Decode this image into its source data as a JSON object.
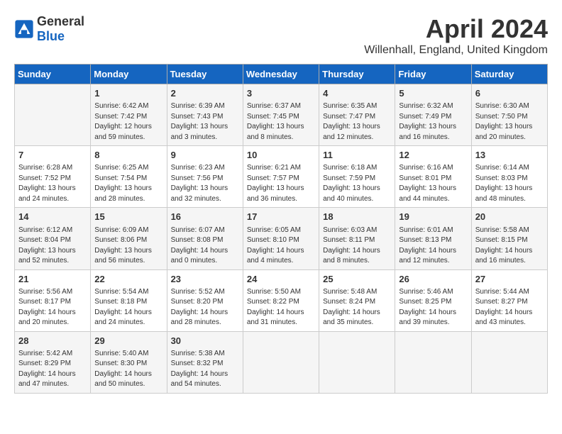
{
  "header": {
    "logo": {
      "general": "General",
      "blue": "Blue"
    },
    "title": "April 2024",
    "subtitle": "Willenhall, England, United Kingdom"
  },
  "columns": [
    "Sunday",
    "Monday",
    "Tuesday",
    "Wednesday",
    "Thursday",
    "Friday",
    "Saturday"
  ],
  "weeks": [
    [
      {
        "day": "",
        "info": ""
      },
      {
        "day": "1",
        "info": "Sunrise: 6:42 AM\nSunset: 7:42 PM\nDaylight: 12 hours\nand 59 minutes."
      },
      {
        "day": "2",
        "info": "Sunrise: 6:39 AM\nSunset: 7:43 PM\nDaylight: 13 hours\nand 3 minutes."
      },
      {
        "day": "3",
        "info": "Sunrise: 6:37 AM\nSunset: 7:45 PM\nDaylight: 13 hours\nand 8 minutes."
      },
      {
        "day": "4",
        "info": "Sunrise: 6:35 AM\nSunset: 7:47 PM\nDaylight: 13 hours\nand 12 minutes."
      },
      {
        "day": "5",
        "info": "Sunrise: 6:32 AM\nSunset: 7:49 PM\nDaylight: 13 hours\nand 16 minutes."
      },
      {
        "day": "6",
        "info": "Sunrise: 6:30 AM\nSunset: 7:50 PM\nDaylight: 13 hours\nand 20 minutes."
      }
    ],
    [
      {
        "day": "7",
        "info": "Sunrise: 6:28 AM\nSunset: 7:52 PM\nDaylight: 13 hours\nand 24 minutes."
      },
      {
        "day": "8",
        "info": "Sunrise: 6:25 AM\nSunset: 7:54 PM\nDaylight: 13 hours\nand 28 minutes."
      },
      {
        "day": "9",
        "info": "Sunrise: 6:23 AM\nSunset: 7:56 PM\nDaylight: 13 hours\nand 32 minutes."
      },
      {
        "day": "10",
        "info": "Sunrise: 6:21 AM\nSunset: 7:57 PM\nDaylight: 13 hours\nand 36 minutes."
      },
      {
        "day": "11",
        "info": "Sunrise: 6:18 AM\nSunset: 7:59 PM\nDaylight: 13 hours\nand 40 minutes."
      },
      {
        "day": "12",
        "info": "Sunrise: 6:16 AM\nSunset: 8:01 PM\nDaylight: 13 hours\nand 44 minutes."
      },
      {
        "day": "13",
        "info": "Sunrise: 6:14 AM\nSunset: 8:03 PM\nDaylight: 13 hours\nand 48 minutes."
      }
    ],
    [
      {
        "day": "14",
        "info": "Sunrise: 6:12 AM\nSunset: 8:04 PM\nDaylight: 13 hours\nand 52 minutes."
      },
      {
        "day": "15",
        "info": "Sunrise: 6:09 AM\nSunset: 8:06 PM\nDaylight: 13 hours\nand 56 minutes."
      },
      {
        "day": "16",
        "info": "Sunrise: 6:07 AM\nSunset: 8:08 PM\nDaylight: 14 hours\nand 0 minutes."
      },
      {
        "day": "17",
        "info": "Sunrise: 6:05 AM\nSunset: 8:10 PM\nDaylight: 14 hours\nand 4 minutes."
      },
      {
        "day": "18",
        "info": "Sunrise: 6:03 AM\nSunset: 8:11 PM\nDaylight: 14 hours\nand 8 minutes."
      },
      {
        "day": "19",
        "info": "Sunrise: 6:01 AM\nSunset: 8:13 PM\nDaylight: 14 hours\nand 12 minutes."
      },
      {
        "day": "20",
        "info": "Sunrise: 5:58 AM\nSunset: 8:15 PM\nDaylight: 14 hours\nand 16 minutes."
      }
    ],
    [
      {
        "day": "21",
        "info": "Sunrise: 5:56 AM\nSunset: 8:17 PM\nDaylight: 14 hours\nand 20 minutes."
      },
      {
        "day": "22",
        "info": "Sunrise: 5:54 AM\nSunset: 8:18 PM\nDaylight: 14 hours\nand 24 minutes."
      },
      {
        "day": "23",
        "info": "Sunrise: 5:52 AM\nSunset: 8:20 PM\nDaylight: 14 hours\nand 28 minutes."
      },
      {
        "day": "24",
        "info": "Sunrise: 5:50 AM\nSunset: 8:22 PM\nDaylight: 14 hours\nand 31 minutes."
      },
      {
        "day": "25",
        "info": "Sunrise: 5:48 AM\nSunset: 8:24 PM\nDaylight: 14 hours\nand 35 minutes."
      },
      {
        "day": "26",
        "info": "Sunrise: 5:46 AM\nSunset: 8:25 PM\nDaylight: 14 hours\nand 39 minutes."
      },
      {
        "day": "27",
        "info": "Sunrise: 5:44 AM\nSunset: 8:27 PM\nDaylight: 14 hours\nand 43 minutes."
      }
    ],
    [
      {
        "day": "28",
        "info": "Sunrise: 5:42 AM\nSunset: 8:29 PM\nDaylight: 14 hours\nand 47 minutes."
      },
      {
        "day": "29",
        "info": "Sunrise: 5:40 AM\nSunset: 8:30 PM\nDaylight: 14 hours\nand 50 minutes."
      },
      {
        "day": "30",
        "info": "Sunrise: 5:38 AM\nSunset: 8:32 PM\nDaylight: 14 hours\nand 54 minutes."
      },
      {
        "day": "",
        "info": ""
      },
      {
        "day": "",
        "info": ""
      },
      {
        "day": "",
        "info": ""
      },
      {
        "day": "",
        "info": ""
      }
    ]
  ]
}
